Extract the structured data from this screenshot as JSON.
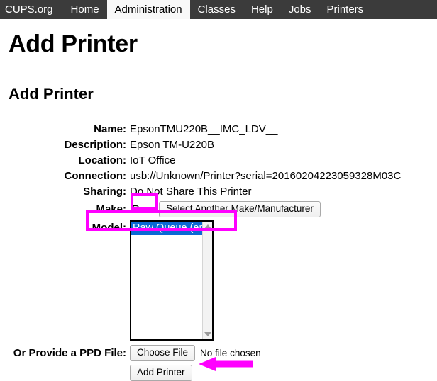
{
  "nav": {
    "items": [
      {
        "label": "CUPS.org",
        "active": false
      },
      {
        "label": "Home",
        "active": false
      },
      {
        "label": "Administration",
        "active": true
      },
      {
        "label": "Classes",
        "active": false
      },
      {
        "label": "Help",
        "active": false
      },
      {
        "label": "Jobs",
        "active": false
      },
      {
        "label": "Printers",
        "active": false
      }
    ]
  },
  "page": {
    "title": "Add Printer",
    "section_title": "Add Printer"
  },
  "form": {
    "name_label": "Name:",
    "name_value": "EpsonTMU220B__IMC_LDV__",
    "description_label": "Description:",
    "description_value": "Epson TM-U220B",
    "location_label": "Location:",
    "location_value": "IoT Office",
    "connection_label": "Connection:",
    "connection_value": "usb://Unknown/Printer?serial=20160204223059328M03C",
    "sharing_label": "Sharing:",
    "sharing_value": "Do Not Share This Printer",
    "make_label": "Make:",
    "make_value": "Raw",
    "make_button_label": "Select Another Make/Manufacturer",
    "model_label": "Model:",
    "model_options": [
      "Raw Queue (en)"
    ],
    "model_selected": "Raw Queue (en)",
    "ppd_label": "Or Provide a PPD File:",
    "choose_file_label": "Choose File",
    "no_file_text": "No file chosen",
    "add_printer_label": "Add Printer"
  },
  "annotations": {
    "highlight_color": "#ff00ff",
    "arrow_color": "#ff00ff"
  }
}
